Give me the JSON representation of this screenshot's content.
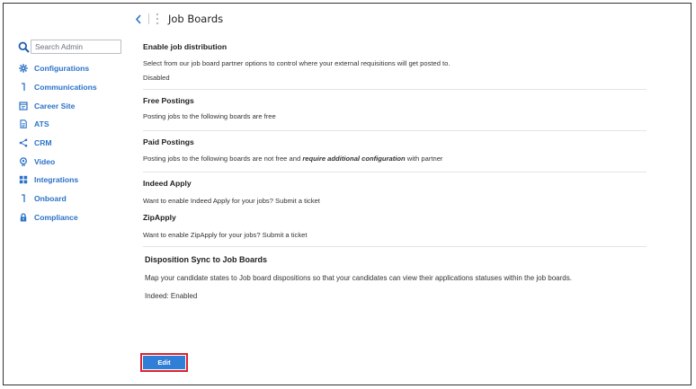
{
  "header": {
    "title": "Job Boards",
    "back_icon": "chevron-left-icon",
    "menu_icon": "kebab-icon"
  },
  "sidebar": {
    "search": {
      "placeholder": "Search Admin",
      "value": ""
    },
    "items": [
      {
        "label": "Configurations",
        "icon": "gear-icon"
      },
      {
        "label": "Communications",
        "icon": "bracket-icon"
      },
      {
        "label": "Career Site",
        "icon": "window-icon"
      },
      {
        "label": "ATS",
        "icon": "document-icon"
      },
      {
        "label": "CRM",
        "icon": "share-icon"
      },
      {
        "label": "Video",
        "icon": "webcam-icon"
      },
      {
        "label": "Integrations",
        "icon": "grid-icon"
      },
      {
        "label": "Onboard",
        "icon": "bracket-icon"
      },
      {
        "label": "Compliance",
        "icon": "lock-icon"
      }
    ]
  },
  "main": {
    "distribution": {
      "title": "Enable job distribution",
      "description": "Select from our job board partner options to control where your external requisitions will get posted to.",
      "status": "Disabled"
    },
    "free_postings": {
      "title": "Free Postings",
      "description": "Posting jobs to the following boards are free"
    },
    "paid_postings": {
      "title": "Paid Postings",
      "description_prefix": "Posting jobs to the following boards are not free and ",
      "description_emphasis": "require additional configuration",
      "description_suffix": " with partner"
    },
    "indeed_apply": {
      "title": "Indeed Apply",
      "description": "Want to enable Indeed Apply for your jobs? Submit a ticket"
    },
    "zip_apply": {
      "title": "ZipApply",
      "description": "Want to enable ZipApply for your jobs? Submit a ticket"
    },
    "disposition_sync": {
      "title": "Disposition Sync to Job Boards",
      "description": "Map your candidate states to Job board dispositions so that your candidates can view their applications statuses within the job boards.",
      "status": "Indeed: Enabled"
    },
    "edit_label": "Edit"
  },
  "colors": {
    "accent": "#2a72c8",
    "button": "#2f7ed8",
    "highlight": "#d9262f"
  }
}
